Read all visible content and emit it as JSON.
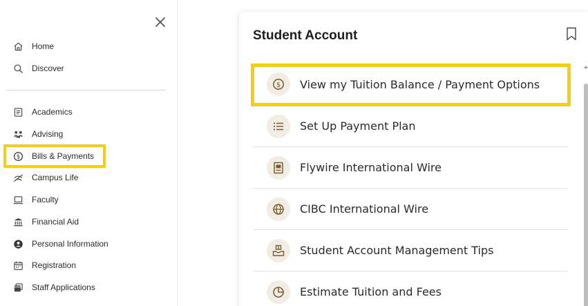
{
  "sidebar": {
    "items": [
      {
        "label": "Home",
        "icon": "home-icon"
      },
      {
        "label": "Discover",
        "icon": "search-icon"
      },
      {
        "label": "Academics",
        "icon": "notes-icon"
      },
      {
        "label": "Advising",
        "icon": "advising-icon"
      },
      {
        "label": "Bills & Payments",
        "icon": "dollar-circle-icon"
      },
      {
        "label": "Campus Life",
        "icon": "campus-life-icon"
      },
      {
        "label": "Faculty",
        "icon": "laptop-icon"
      },
      {
        "label": "Financial Aid",
        "icon": "bank-icon"
      },
      {
        "label": "Personal Information",
        "icon": "person-circle-icon"
      },
      {
        "label": "Registration",
        "icon": "calendar-icon"
      },
      {
        "label": "Staff Applications",
        "icon": "windows-icon"
      }
    ],
    "highlighted": "Bills & Payments"
  },
  "panel": {
    "title": "Student Account",
    "items": [
      {
        "label": "View my Tuition Balance / Payment Options",
        "icon": "dollar-circle-icon"
      },
      {
        "label": "Set Up Payment Plan",
        "icon": "list-icon"
      },
      {
        "label": "Flywire International Wire",
        "icon": "document-icon"
      },
      {
        "label": "CIBC International Wire",
        "icon": "globe-icon"
      },
      {
        "label": "Student Account Management Tips",
        "icon": "hand-gift-icon"
      },
      {
        "label": "Estimate Tuition and Fees",
        "icon": "pie-chart-icon"
      }
    ],
    "highlighted": "View my Tuition Balance / Payment Options"
  },
  "colors": {
    "highlight": "#f5cd17",
    "icon_circle_bg": "#f1ece4",
    "icon_accent": "#7a5c2e"
  }
}
